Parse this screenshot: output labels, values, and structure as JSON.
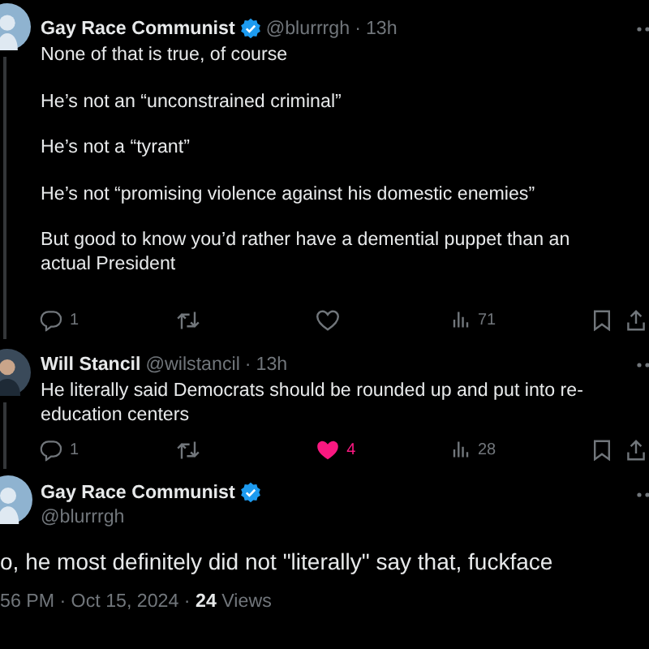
{
  "replies": [
    {
      "author": "Gay Race Communist",
      "verified": true,
      "handle": "@blurrrgh",
      "time": "13h",
      "separator": "·",
      "paragraphs": [
        "None of that is true, of course",
        "He’s not an “unconstrained criminal”",
        "He’s not a “tyrant”",
        "He’s not “promising violence against his domestic enemies”",
        "But good to know you’d rather have a demential puppet than an actual President"
      ],
      "actions": {
        "replies": "1",
        "liked": false,
        "views": "71"
      }
    },
    {
      "author": "Will Stancil",
      "verified": false,
      "handle": "@wilstancil",
      "time": "13h",
      "separator": "·",
      "paragraphs": [
        "He literally said Democrats should be rounded up and put into re-education centers"
      ],
      "actions": {
        "replies": "1",
        "likes": "4",
        "liked": true,
        "views": "28"
      }
    }
  ],
  "focused": {
    "author": "Gay Race Communist",
    "verified": true,
    "handle": "@blurrrgh",
    "text": "o, he most definitely did not \"literally\" say that, fuckface",
    "timestamp": "56 PM · Oct 15, 2024 · ",
    "views": "24",
    "views_label": "Views"
  }
}
